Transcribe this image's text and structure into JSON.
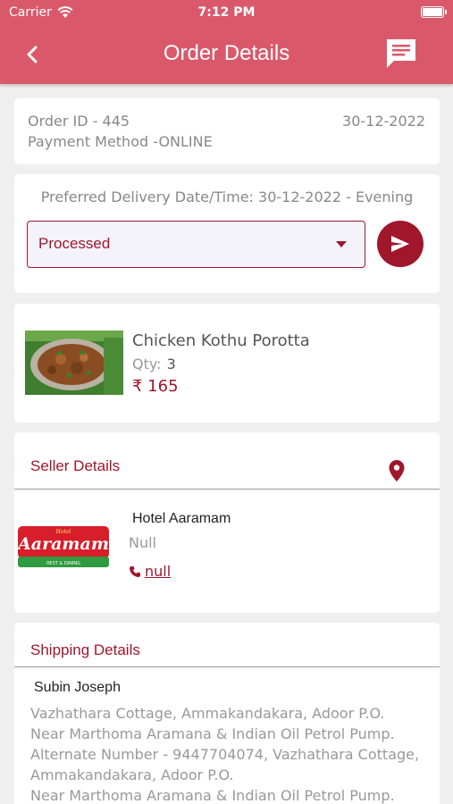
{
  "status_bar": {
    "carrier": "Carrier",
    "time": "7:12 PM"
  },
  "nav": {
    "title": "Order Details",
    "back_icon": "chevron-left-icon",
    "chat_icon": "chat-icon"
  },
  "colors": {
    "header": "#d9596a",
    "accent": "#a0162b",
    "background": "#efefef"
  },
  "order": {
    "id_text": "Order ID - 445",
    "date": "30-12-2022",
    "payment_text": "Payment Method -ONLINE"
  },
  "delivery": {
    "preferred_text": "Preferred Delivery Date/Time: 30-12-2022 - Evening",
    "status_value": "Processed"
  },
  "item": {
    "name": "Chicken Kothu Porotta",
    "qty_label": "Qty:",
    "qty": "3",
    "price": "₹ 165"
  },
  "seller": {
    "heading": "Seller Details",
    "logo_small": "Hotel",
    "logo_text": "Aaramam",
    "logo_tag": "REST & DINING",
    "name": "Hotel Aaramam",
    "sub": "Null",
    "phone": " null"
  },
  "shipping": {
    "heading": "Shipping Details",
    "name": "Subin Joseph",
    "address_lines": [
      "Vazhathara Cottage, Ammakandakara, Adoor P.O.",
      "Near Marthoma Aramana & Indian Oil Petrol Pump.",
      "Alternate Number - 9447704074, Vazhathara Cottage,",
      "Ammakandakara, Adoor P.O.",
      "Near Marthoma Aramana & Indian Oil Petrol Pump."
    ]
  }
}
